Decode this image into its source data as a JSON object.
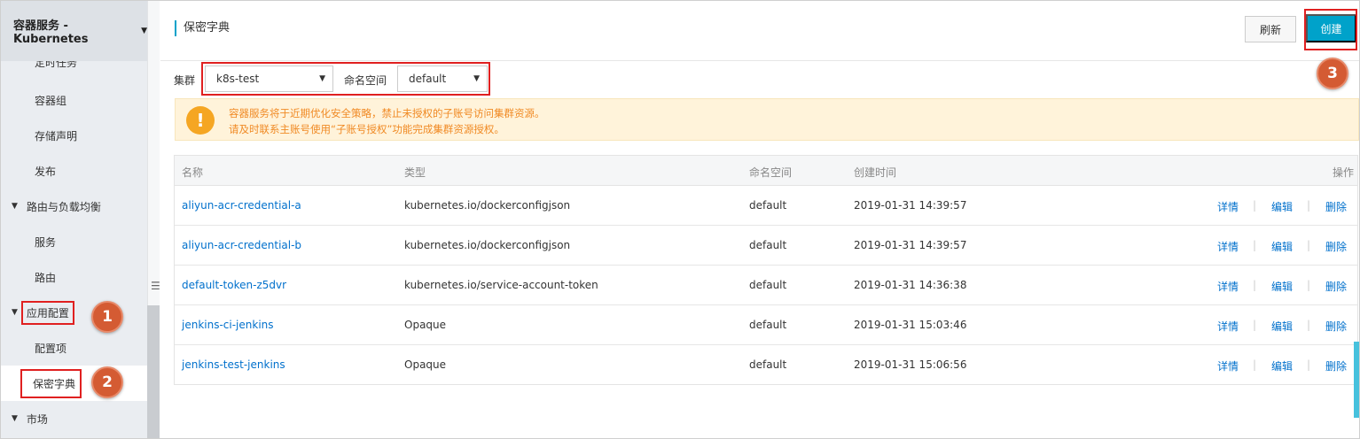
{
  "sidebar": {
    "header": "容器服务 - Kubernetes",
    "items": [
      {
        "label": "定时任务"
      },
      {
        "label": "容器组"
      },
      {
        "label": "存储声明"
      },
      {
        "label": "发布"
      },
      {
        "label": "路由与负载均衡"
      },
      {
        "label": "服务"
      },
      {
        "label": "路由"
      },
      {
        "label": "应用配置"
      },
      {
        "label": "配置项"
      },
      {
        "label": "保密字典"
      },
      {
        "label": "市场"
      }
    ]
  },
  "annotations": {
    "step1": "1",
    "step2": "2",
    "step3": "3"
  },
  "header": {
    "title": "保密字典",
    "refresh_label": "刷新",
    "create_label": "创建"
  },
  "filters": {
    "cluster_label": "集群",
    "cluster_value": "k8s-test",
    "namespace_label": "命名空间",
    "namespace_value": "default"
  },
  "notice": {
    "icon": "!",
    "line1": "容器服务将于近期优化安全策略，禁止未授权的子账号访问集群资源。",
    "line2": "请及时联系主账号使用“子账号授权”功能完成集群资源授权。"
  },
  "table": {
    "columns": [
      "名称",
      "类型",
      "命名空间",
      "创建时间",
      "操作"
    ],
    "actions": {
      "detail": "详情",
      "edit": "编辑",
      "delete": "删除"
    },
    "rows": [
      {
        "name": "aliyun-acr-credential-a",
        "type": "kubernetes.io/dockerconfigjson",
        "namespace": "default",
        "created": "2019-01-31 14:39:57"
      },
      {
        "name": "aliyun-acr-credential-b",
        "type": "kubernetes.io/dockerconfigjson",
        "namespace": "default",
        "created": "2019-01-31 14:39:57"
      },
      {
        "name": "default-token-z5dvr",
        "type": "kubernetes.io/service-account-token",
        "namespace": "default",
        "created": "2019-01-31 14:36:38"
      },
      {
        "name": "jenkins-ci-jenkins",
        "type": "Opaque",
        "namespace": "default",
        "created": "2019-01-31 15:03:46"
      },
      {
        "name": "jenkins-test-jenkins",
        "type": "Opaque",
        "namespace": "default",
        "created": "2019-01-31 15:06:56"
      }
    ]
  },
  "colors": {
    "accent": "#00a2ca",
    "link": "#0070cc",
    "warning": "#f08a24",
    "highlight": "#e02020",
    "badge": "#d45b33"
  }
}
